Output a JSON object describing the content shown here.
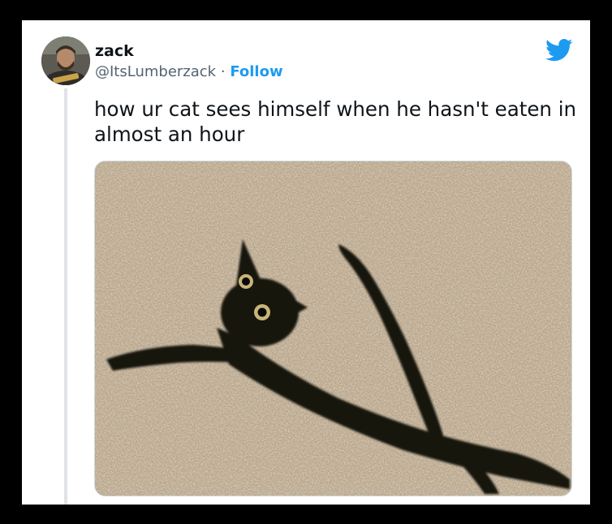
{
  "tweet": {
    "display_name": "zack",
    "handle": "@ItsLumberzack",
    "separator": "·",
    "follow_label": "Follow",
    "text": "how ur cat sees himself when he hasn't eaten in almost an hour",
    "bird_icon": "twitter-bird-icon",
    "accent_color": "#1d9bf0",
    "media": {
      "subject": "black cat stretched flat on beige carpet"
    }
  }
}
